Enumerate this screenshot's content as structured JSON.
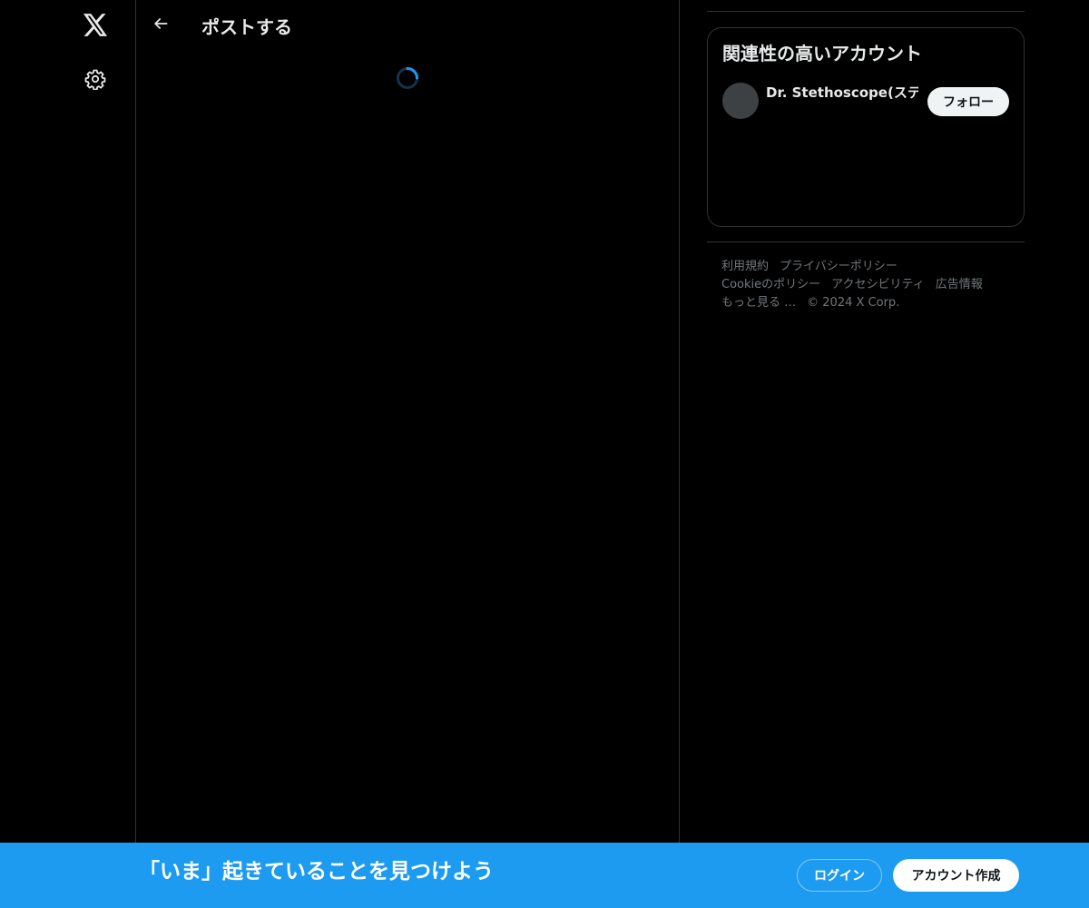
{
  "nav": {
    "logo_icon": "x-logo-icon",
    "settings_icon": "gear-icon"
  },
  "header": {
    "back_icon": "arrow-left-icon",
    "title": "ポストする"
  },
  "main": {
    "loading_icon": "spinner-icon"
  },
  "sidebar": {
    "related_title": "関連性の高いアカウント",
    "accounts": [
      {
        "name": "Dr. Stethoscope(ステー",
        "follow_label": "フォロー"
      }
    ],
    "footer": {
      "line1": [
        "利用規約",
        "プライバシーポリシー"
      ],
      "line2": [
        "Cookieのポリシー",
        "アクセシビリティ",
        "広告情報"
      ],
      "line3": [
        "もっと見る …",
        "© 2024 X Corp."
      ]
    }
  },
  "bottom_bar": {
    "text": "「いま」起きていることを見つけよう",
    "login_label": "ログイン",
    "signup_label": "アカウント作成"
  },
  "colors": {
    "background": "#000000",
    "accent": "#1d9bf0",
    "text": "#e7e9ea",
    "muted": "#71767b",
    "border": "#2f3336"
  }
}
